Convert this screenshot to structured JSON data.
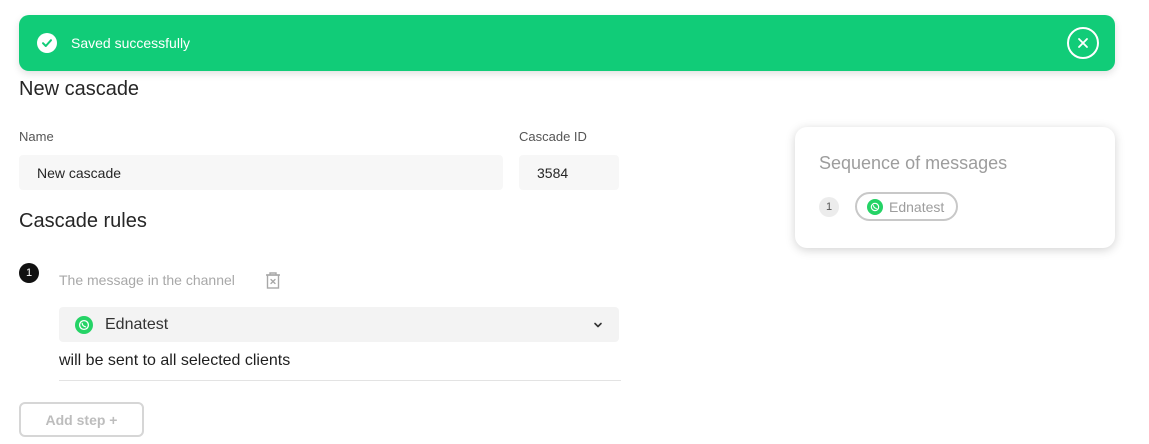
{
  "toast": {
    "message": "Saved successfully",
    "color": "#11cc78"
  },
  "page": {
    "title": "New cascade"
  },
  "form": {
    "name_label": "Name",
    "name_value": "New cascade",
    "id_label": "Cascade ID",
    "id_value": "3584"
  },
  "rules": {
    "title": "Cascade rules",
    "steps": [
      {
        "number": "1",
        "label": "The message in the channel",
        "channel": "Ednatest",
        "channel_icon": "whatsapp-icon",
        "note": "will be sent to all selected clients"
      }
    ],
    "add_step_label": "Add step +"
  },
  "sequence": {
    "title": "Sequence of messages",
    "items": [
      {
        "number": "1",
        "channel": "Ednatest",
        "channel_icon": "whatsapp-icon"
      }
    ]
  }
}
